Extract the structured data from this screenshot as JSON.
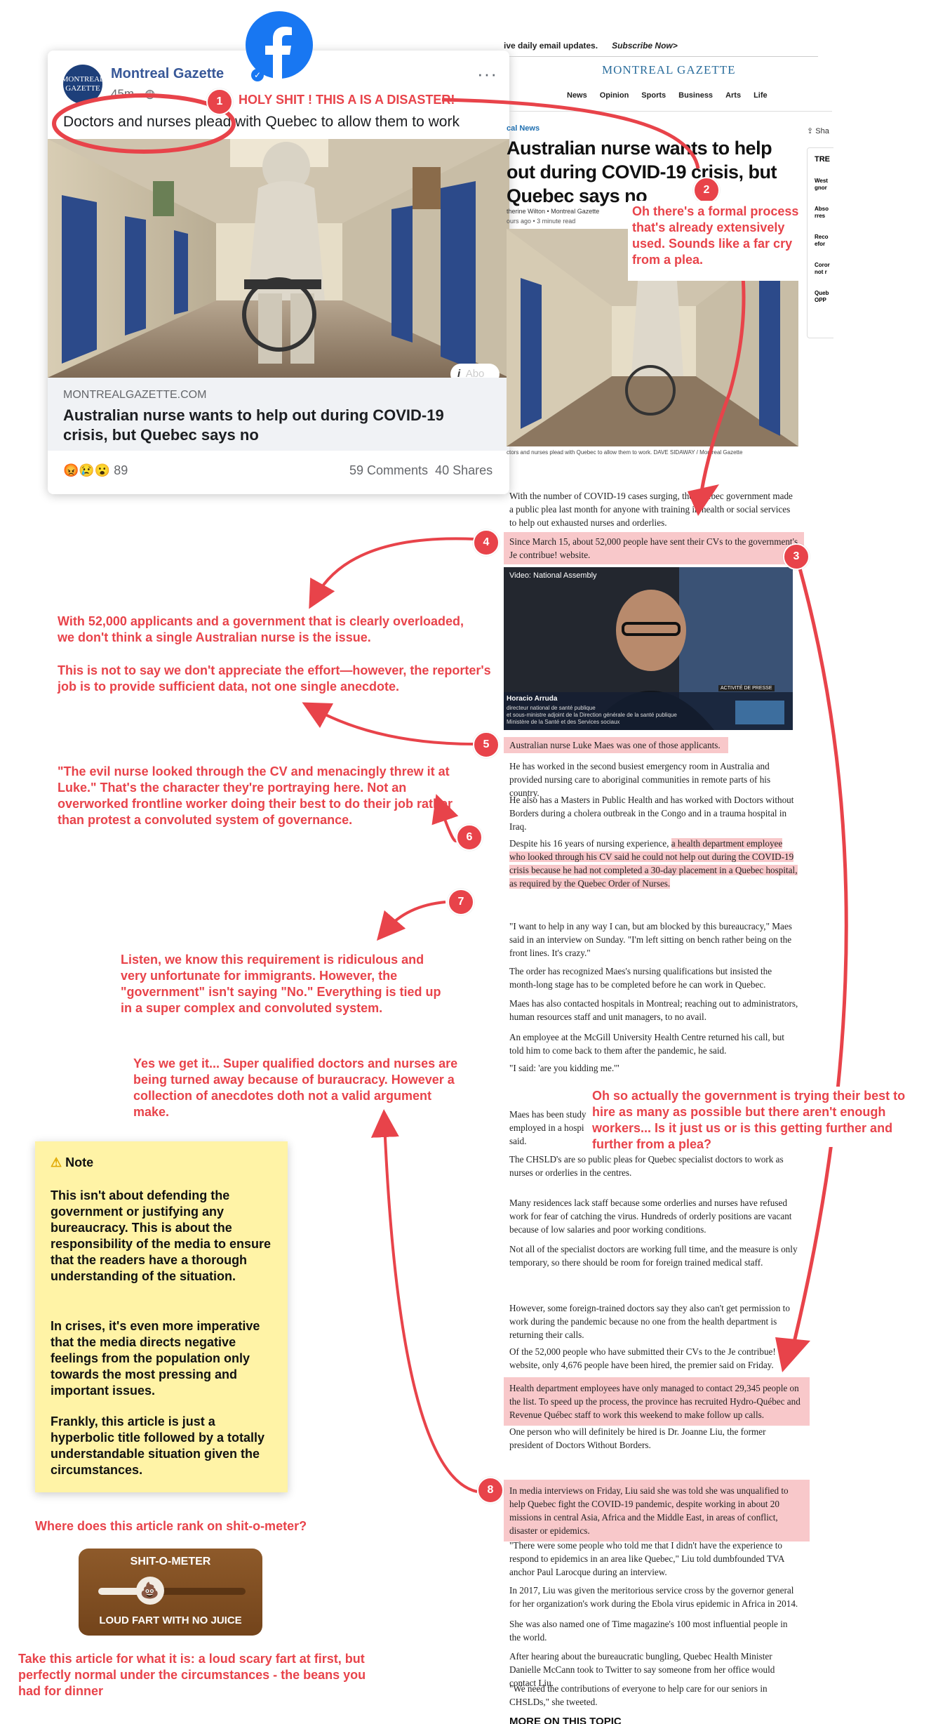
{
  "facebook_post": {
    "page_name": "Montreal Gazette",
    "avatar_text": "MONTREAL GAZETTE",
    "time": "45m ·",
    "post_text": "Doctors and nurses plead with Quebec to allow them to work",
    "link_domain": "MONTREALGAZETTE.COM",
    "link_headline": "Australian nurse wants to help out during COVID-19 crisis, but Quebec says no",
    "reaction_count": "89",
    "reaction_emojis": "😡😢😮",
    "comments": "59 Comments",
    "shares": "40 Shares",
    "info_label": "Abo",
    "more_icon": "···"
  },
  "article": {
    "promo_text": "ive daily email updates.",
    "promo_link": "Subscribe Now>",
    "masthead": "MONTREAL GAZETTE",
    "nav": [
      "News",
      "Opinion",
      "Sports",
      "Business",
      "Arts",
      "Life"
    ],
    "section": "cal News",
    "share": "Sha",
    "headline": "Australian nurse wants to help out during COVID-19 crisis, but Quebec says no",
    "byline": "therine Wilton  •  Montreal Gazette",
    "dateline": "ours ago  •  3 minute read",
    "trending_label": "TRE",
    "trending_items": [
      "West gnor",
      "Abso rres",
      "Reco efor",
      "Coror not r",
      "Queb OPP"
    ],
    "photo_caption": "ctors and nurses plead with Quebec to allow them to work. DAVE SIDAWAY / Montreal Gazette",
    "video_label": "Video: National Assembly",
    "video_person": "Horacio Arruda",
    "video_title_lines": [
      "directeur national de santé publique",
      "et sous-ministre adjoint de la Direction générale de la santé publique",
      "Ministère de la Santé et des Services sociaux"
    ],
    "video_tag": "ACTIVITÉ DE PRESSE",
    "paragraphs": {
      "p1": "With the number of COVID-19 cases surging, the Quebec government made a public plea last month for anyone with training in health or social services to help out exhausted nurses and orderlies.",
      "p2": "Since March 15, about 52,000 people have sent their CVs to the government's Je contribue! website.",
      "p3": "Australian nurse Luke Maes was one of those applicants.",
      "p4": "He has worked in the second busiest emergency room in Australia and provided nursing care to aboriginal communities in remote parts of his country.",
      "p5": "He also has a Masters in Public Health and has worked with Doctors without Borders during a cholera outbreak in the Congo and in a trauma hospital in Iraq.",
      "p6a": "Despite his 16 years of nursing experience, ",
      "p6b": "a health department employee who looked through his CV said he could not help out during the COVID-19 crisis because he had not completed a 30-day placement in a Quebec hospital, as required by the Quebec Order of Nurses.",
      "p7": "\"I want to help in any way I can, but am blocked by this bureaucracy,\" Maes said in an interview on Sunday. \"I'm left sitting on bench rather being on the front lines.  It's crazy.\"",
      "p8": "The order has recognized Maes's nursing qualifications but insisted the month-long stage has to be completed before he can work in Quebec.",
      "p9": "Maes has also contacted hospitals in Montreal; reaching out to administrators, human resources staff and unit managers, to no avail.",
      "p10": "An employee at the McGill University Health Centre returned his call, but told him to come back to them after the pandemic, he said.",
      "p11": "\"I said: 'are you kidding me.'\"",
      "p12": "Maes has been study employed in a hospi said.",
      "p13": "The CHSLD's are so public pleas for Quebec specialist doctors to work as nurses or orderlies in the centres.",
      "p14": "Many residences lack staff because some orderlies and nurses have refused work for fear of catching the virus. Hundreds of orderly positions are vacant because of low salaries and poor working conditions.",
      "p15": "Not all of the specialist doctors are working full time, and the measure is only temporary, so there should be room for foreign trained medical staff.",
      "p16": "However, some foreign-trained doctors say they also can't get permission to work during the pandemic because no one from the health department is returning their calls.",
      "p17": "Of the 52,000 people who have submitted their CVs to the Je contribue! website, only 4,676 people have been hired, the premier said on Friday.",
      "p18": "Health department employees have only managed to contact 29,345 people on the list. To speed up the process, the province has recruited Hydro-Québec and Revenue Québec staff to work this weekend to make follow up calls.",
      "p19": "One person who will definitely be hired is Dr. Joanne Liu, the former president of Doctors Without Borders.",
      "p20": "In media interviews on Friday, Liu said she was told she was unqualified to help Quebec fight the COVID-19 pandemic, despite working in about 20 missions in central Asia, Africa and the Middle East, in areas of conflict, disaster or epidemics.",
      "p21": "\"There were some people who told me that I didn't have the experience to respond to epidemics in an area like Quebec,\" Liu told dumbfounded TVA anchor Paul Larocque during an interview.",
      "p22": "In 2017, Liu was given the meritorious service cross by the governor general for her organization's work during the Ebola virus epidemic in Africa in 2014.",
      "p23": "She was also named one of Time magazine's 100 most influential people in the world.",
      "p24": "After hearing about the bureaucratic bungling, Quebec Health Minister Danielle McCann took to Twitter to say someone from her office would contact Liu.",
      "p25": "\"We need the contributions of everyone to help care for our seniors in CHSLDs,\" she tweeted.",
      "p26": "MORE ON THIS TOPIC"
    }
  },
  "annotations": {
    "c1": "HOLY SHIT ! THIS A IS A DISASTER!",
    "c2": "Oh there's a formal process that's already extensively used. Sounds like a far cry from a plea.",
    "c4a": "With 52,000 applicants and a government that is clearly overloaded, we don't think a single Australian nurse is the issue.",
    "c4b": "This is not to say we don't appreciate the effort—however, the reporter's job is to provide sufficient data, not one single anecdote.",
    "c6": "\"The evil nurse looked through the CV and menacingly threw it at Luke.\" That's the character they're portraying here. Not an overworked frontline worker doing their best to do their job rather than protest a convoluted system of governance.",
    "c7": "Listen, we know this requirement is ridiculous and very unfortunate for immigrants. However, the \"government\" isn't saying \"No.\" Everything is tied up in a super complex and convoluted system.",
    "c8": "Yes we get it... Super qualified doctors and nurses are being turned away because of buraucracy. However a collection of anecdotes doth not a valid argument make.",
    "c3": "Oh so actually the government is trying their best to hire as many as possible but there aren't enough workers... Is it just us or is this getting further and further from a plea?",
    "badges": [
      "1",
      "2",
      "3",
      "4",
      "5",
      "6",
      "7",
      "8"
    ]
  },
  "note": {
    "title": "Note",
    "p1": "This isn't about defending the government or justifying any bureaucracy. This is about the responsibility of the media to ensure that the readers have a thorough understanding of the situation.",
    "p2": "In crises, it's even more imperative that the media directs negative feelings from the population only towards the most pressing and important issues.",
    "p3": "Frankly, this article is just a hyperbolic title followed by a totally understandable situation given the circumstances."
  },
  "meter": {
    "question": "Where does this article rank on shit-o-meter?",
    "title": "SHIT-O-METER",
    "level": 0.35,
    "rating": "LOUD FART WITH NO JUICE",
    "conclusion": "Take this article for what it is: a loud scary fart at first, but perfectly normal under the circumstances - the beans you had for dinner"
  },
  "colors": {
    "accent": "#e8434a",
    "highlight": "#f8c8ca",
    "facebook": "#1877f2",
    "note": "#fff3a6",
    "meter": "#8e5a2a"
  }
}
